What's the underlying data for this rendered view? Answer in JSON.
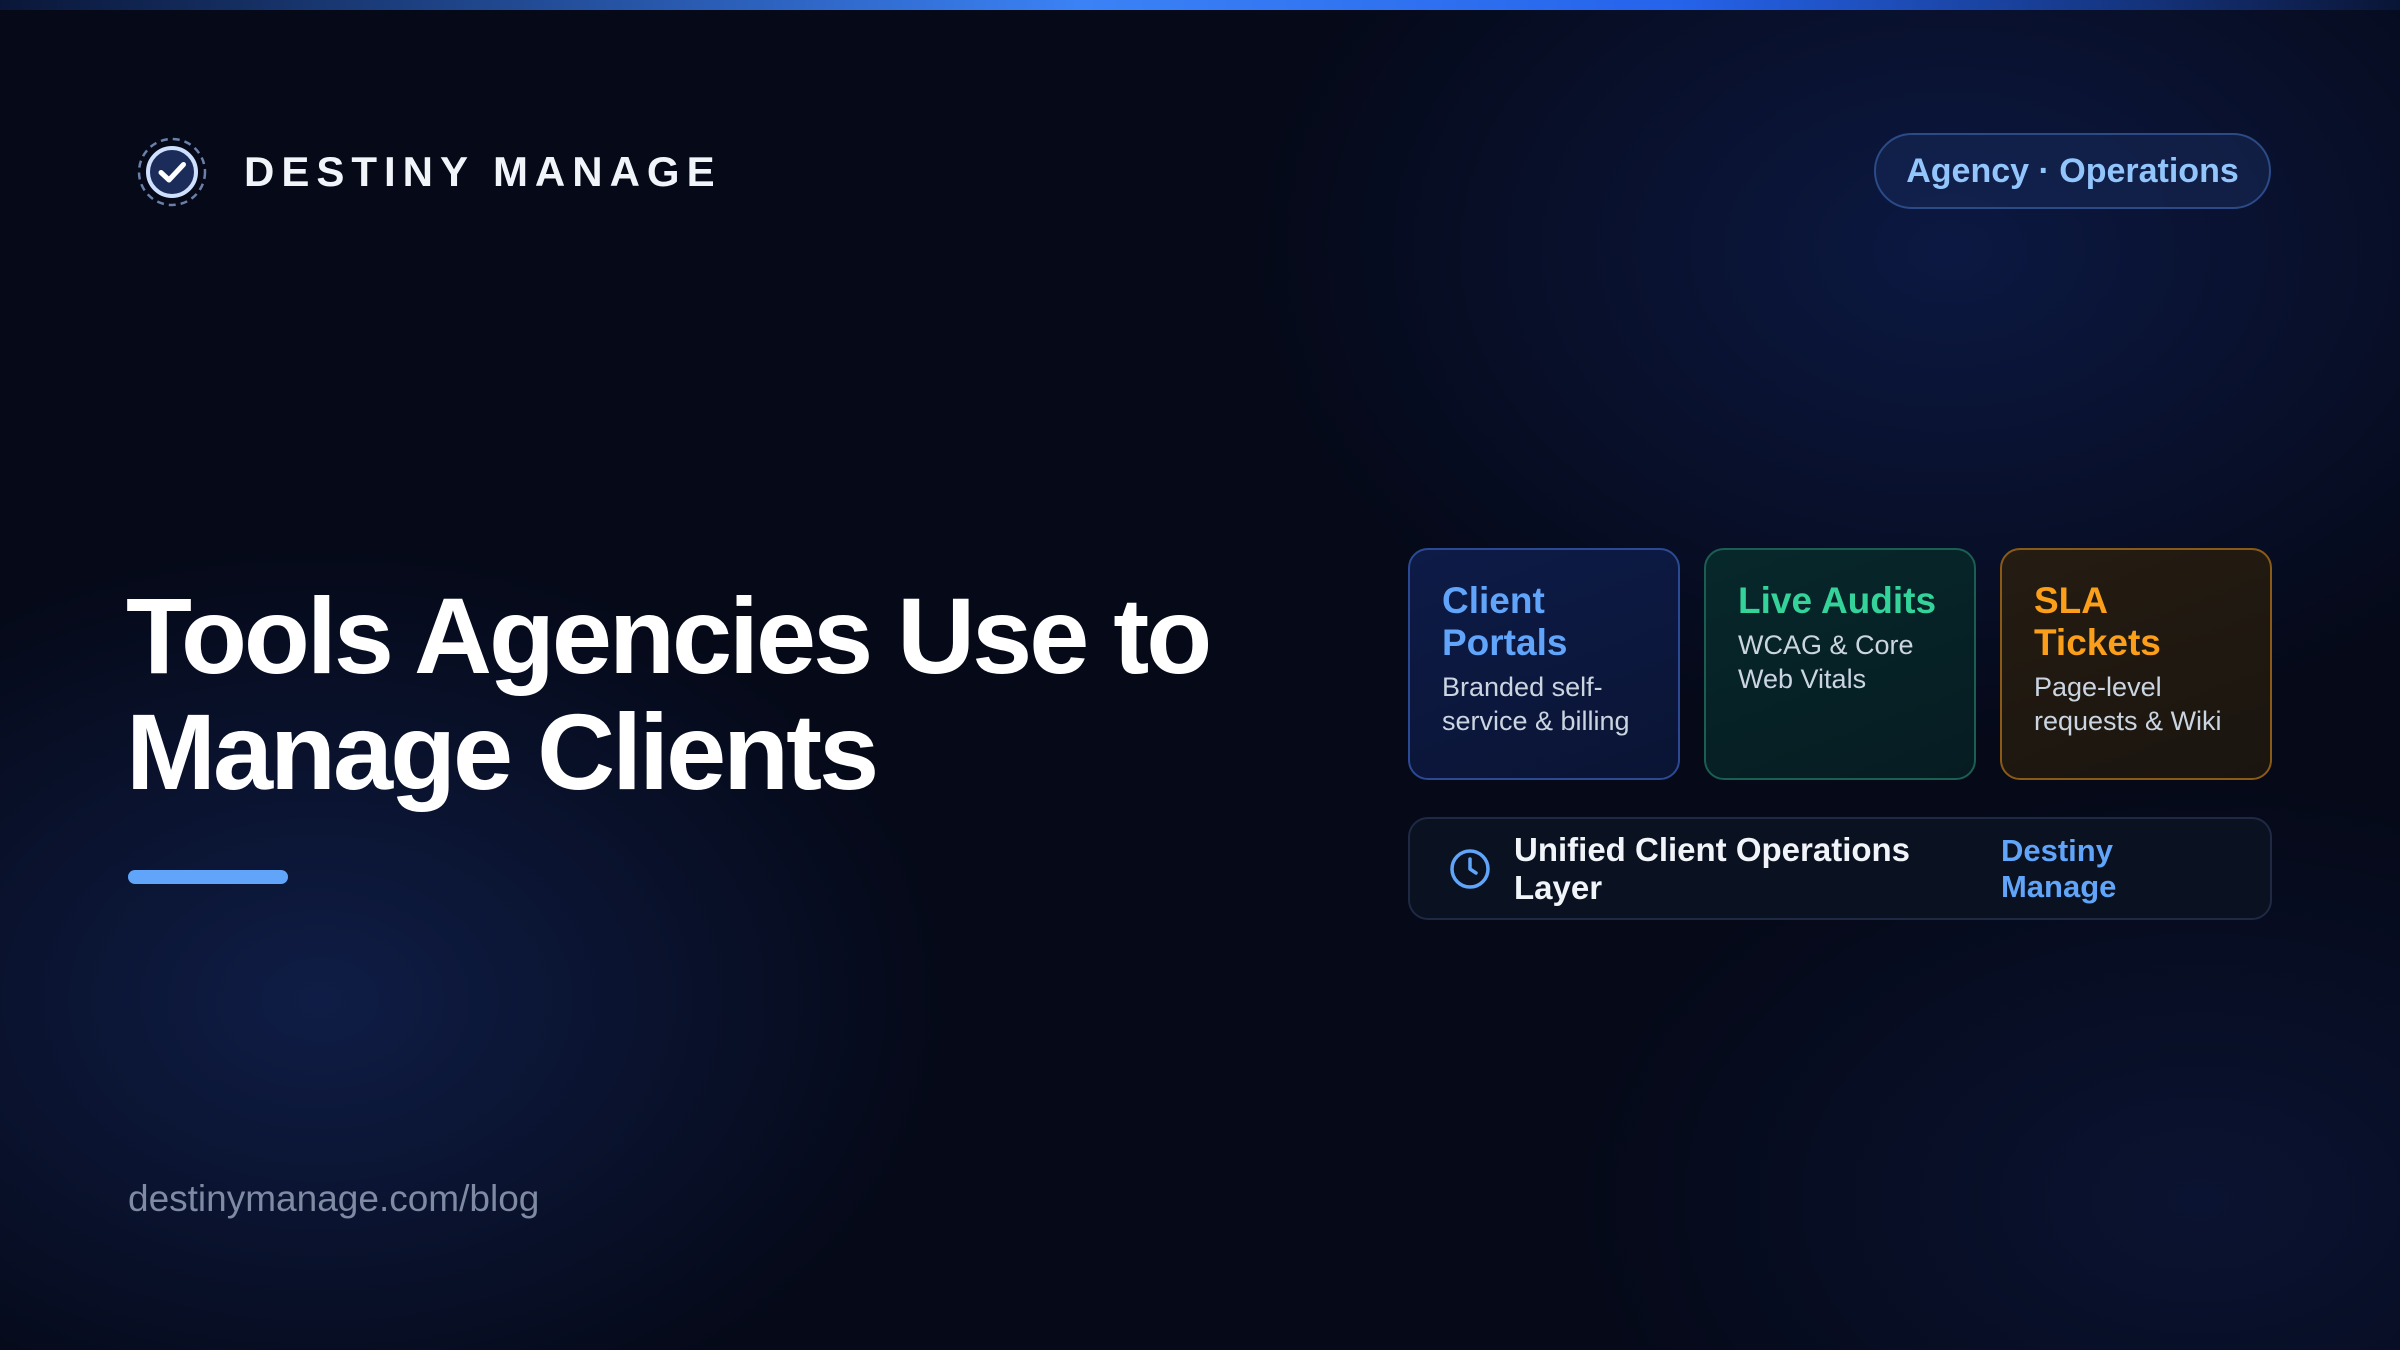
{
  "brand": {
    "name": "DESTINY MANAGE",
    "logo_icon": "check-badge-icon"
  },
  "tag": {
    "label": "Agency · Operations"
  },
  "headline": {
    "title": "Tools Agencies Use to Manage Clients"
  },
  "footer": {
    "url": "destinymanage.com/blog"
  },
  "feature_cards": [
    {
      "title": "Client Portals",
      "description": "Branded self-service & billing",
      "accent": "#60a5fa"
    },
    {
      "title": "Live Audits",
      "description": "WCAG & Core Web Vitals",
      "accent": "#34d399"
    },
    {
      "title": "SLA Tickets",
      "description": "Page-level requests & Wiki",
      "accent": "#fb9f1a"
    }
  ],
  "ops_bar": {
    "icon": "clock-icon",
    "label": "Unified Client Operations Layer",
    "brand": "Destiny Manage"
  },
  "colors": {
    "background": "#050918",
    "accent_blue": "#60a5fa",
    "accent_green": "#34d399",
    "accent_amber": "#fb9f1a"
  }
}
